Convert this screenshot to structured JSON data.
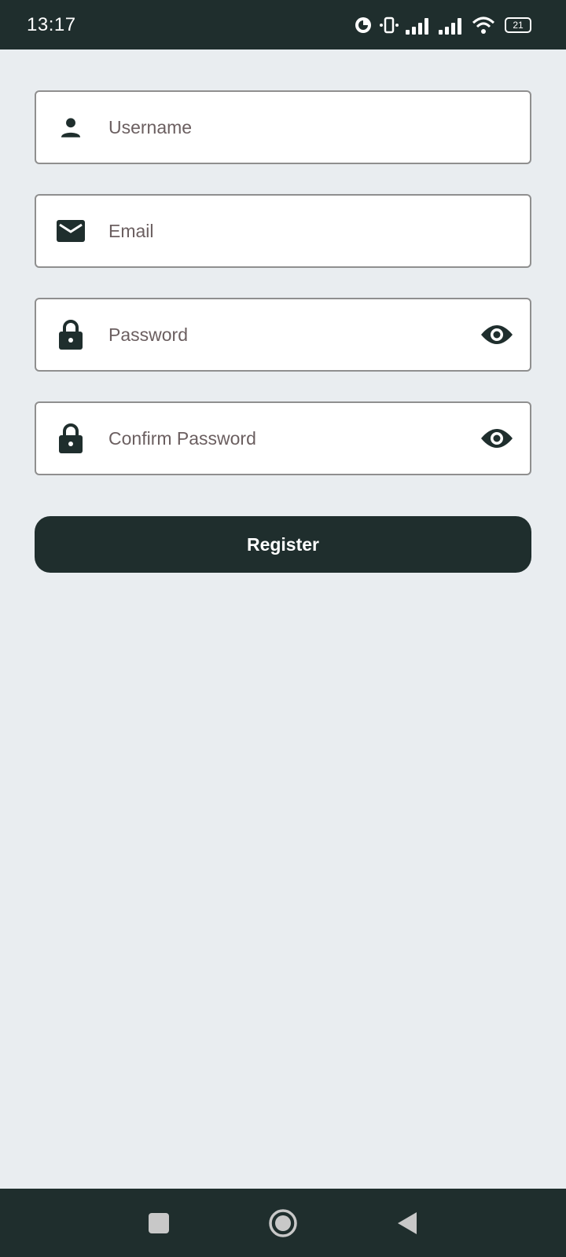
{
  "status_bar": {
    "time": "13:17",
    "battery": "21"
  },
  "form": {
    "username": {
      "placeholder": "Username",
      "icon": "person-icon"
    },
    "email": {
      "placeholder": "Email",
      "icon": "mail-icon"
    },
    "password": {
      "placeholder": "Password",
      "icon": "lock-icon",
      "toggle_icon": "eye-icon"
    },
    "confirm_password": {
      "placeholder": "Confirm Password",
      "icon": "lock-icon",
      "toggle_icon": "eye-icon"
    },
    "register_label": "Register"
  },
  "nav_bar": {
    "items": [
      "recents-square-icon",
      "home-circle-icon",
      "back-triangle-icon"
    ]
  },
  "colors": {
    "primary": "#1f2e2d",
    "background": "#e9edf0",
    "field_border": "#8f8f8f",
    "placeholder": "#6b5f60"
  }
}
